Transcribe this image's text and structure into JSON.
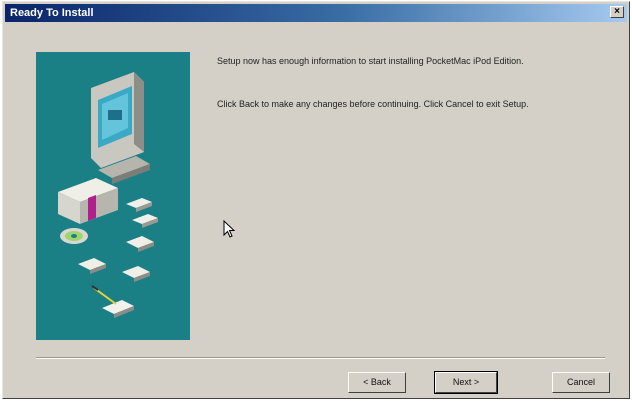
{
  "window": {
    "title": "Ready To Install",
    "close_glyph": "×"
  },
  "content": {
    "message_1": "Setup now has enough information to start installing PocketMac iPod Edition.",
    "message_2": "Click Back to make any changes before continuing. Click Cancel to exit Setup."
  },
  "buttons": {
    "back": "< Back",
    "next": "Next >",
    "cancel": "Cancel"
  },
  "icons": {
    "art": "install-illustration-icon",
    "cursor": "mouse-pointer-icon"
  },
  "colors": {
    "title_bar": "#0a246a",
    "art_background": "#1b8086",
    "dialog_face": "#d4d0c8"
  }
}
